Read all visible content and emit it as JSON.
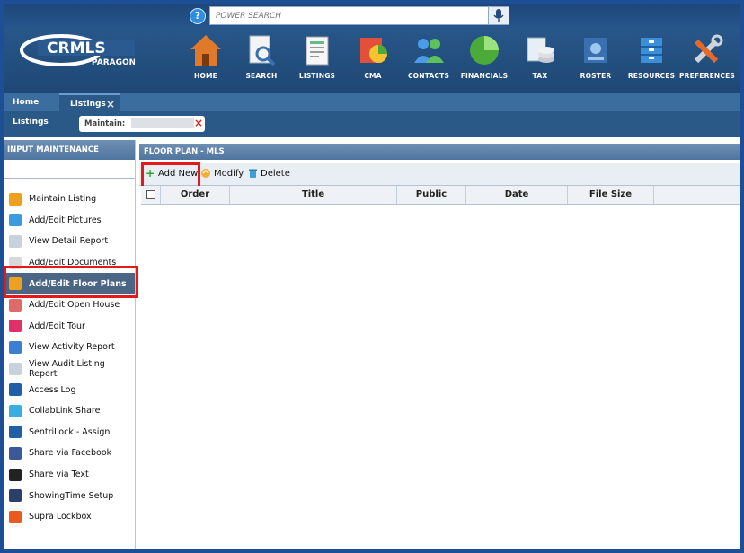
{
  "header": {
    "logo_text": "CRMLS",
    "logo_sub": "PARAGON",
    "search_placeholder": "POWER SEARCH",
    "nav": [
      {
        "label": "HOME",
        "icon": "home-icon"
      },
      {
        "label": "SEARCH",
        "icon": "search-icon"
      },
      {
        "label": "LISTINGS",
        "icon": "listings-icon"
      },
      {
        "label": "CMA",
        "icon": "cma-icon"
      },
      {
        "label": "CONTACTS",
        "icon": "contacts-icon"
      },
      {
        "label": "FINANCIALS",
        "icon": "financials-icon"
      },
      {
        "label": "TAX",
        "icon": "tax-icon"
      },
      {
        "label": "ROSTER",
        "icon": "roster-icon"
      },
      {
        "label": "RESOURCES",
        "icon": "resources-icon"
      },
      {
        "label": "PREFERENCES",
        "icon": "preferences-icon"
      }
    ]
  },
  "tabs": [
    {
      "label": "Home"
    },
    {
      "label": "Listings",
      "close": "×"
    }
  ],
  "subbar": {
    "label": "Listings",
    "maintain_label": "Maintain:",
    "close": "×"
  },
  "left_panel": {
    "title": "INPUT MAINTENANCE",
    "items": [
      {
        "label": "Maintain Listing",
        "icon": "pencil-icon",
        "color": "#f0a020"
      },
      {
        "label": "Add/Edit Pictures",
        "icon": "pictures-icon",
        "color": "#3a9be0"
      },
      {
        "label": "View Detail Report",
        "icon": "report-icon",
        "color": "#c8d2dc"
      },
      {
        "label": "Add/Edit Documents",
        "icon": "documents-icon",
        "color": "#d8d8d8"
      },
      {
        "label": "Add/Edit Floor Plans",
        "icon": "floor-plan-icon",
        "color": "#f0a020",
        "selected": true
      },
      {
        "label": "Add/Edit Open House",
        "icon": "open-house-icon",
        "color": "#e06a6a"
      },
      {
        "label": "Add/Edit Tour",
        "icon": "tour-icon",
        "color": "#e0306a"
      },
      {
        "label": "View Activity Report",
        "icon": "activity-report-icon",
        "color": "#3a7fd0"
      },
      {
        "label": "View Audit Listing Report",
        "icon": "audit-report-icon",
        "color": "#c8d2dc"
      },
      {
        "label": "Access Log",
        "icon": "access-log-icon",
        "color": "#1f5fa8"
      },
      {
        "label": "CollabLink Share",
        "icon": "collablink-icon",
        "color": "#3aaee0"
      },
      {
        "label": "SentriLock - Assign",
        "icon": "sentrilock-icon",
        "color": "#1f5fa8"
      },
      {
        "label": "Share via Facebook",
        "icon": "facebook-icon",
        "color": "#3b5998"
      },
      {
        "label": "Share via Text",
        "icon": "phone-icon",
        "color": "#222222"
      },
      {
        "label": "ShowingTime Setup",
        "icon": "showingtime-icon",
        "color": "#2a3f6a"
      },
      {
        "label": "Supra Lockbox",
        "icon": "supra-lockbox-icon",
        "color": "#e85a20"
      }
    ]
  },
  "main": {
    "title": "FLOOR PLAN - MLS",
    "toolbar": {
      "add_new": "Add New",
      "modify": "Modify",
      "delete": "Delete"
    },
    "columns": [
      "Order",
      "Title",
      "Public",
      "Date",
      "File Size"
    ]
  },
  "colors": {
    "header_bg": "#23507f",
    "accent": "#2a5887",
    "highlight_red": "#e41a1a"
  }
}
